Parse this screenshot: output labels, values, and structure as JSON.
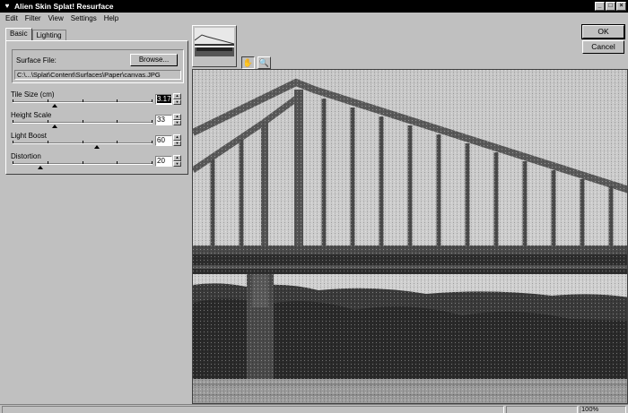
{
  "window": {
    "title": "Alien Skin Splat! Resurface",
    "controls": [
      "_",
      "□",
      "×"
    ]
  },
  "menu": [
    "Edit",
    "Filter",
    "View",
    "Settings",
    "Help"
  ],
  "tabs": [
    {
      "label": "Basic",
      "active": true
    },
    {
      "label": "Lighting",
      "active": false
    }
  ],
  "surface": {
    "label": "Surface File:",
    "browse_label": "Browse...",
    "path": "C:\\...\\Splat\\Content\\Surfaces\\Paper\\canvas.JPG"
  },
  "params": [
    {
      "label": "Tile Size (cm)",
      "value": "3.17",
      "level": 0.3,
      "selected": true
    },
    {
      "label": "Height Scale",
      "value": "33",
      "level": 0.3,
      "selected": false
    },
    {
      "label": "Light Boost",
      "value": "60",
      "level": 0.6,
      "selected": false
    },
    {
      "label": "Distortion",
      "value": "20",
      "level": 0.2,
      "selected": false
    }
  ],
  "dialog": {
    "ok_label": "OK",
    "cancel_label": "Cancel"
  },
  "tools": {
    "hand": "hand-icon",
    "zoom": "magnifier-icon"
  },
  "status": {
    "zoom": "100%"
  }
}
